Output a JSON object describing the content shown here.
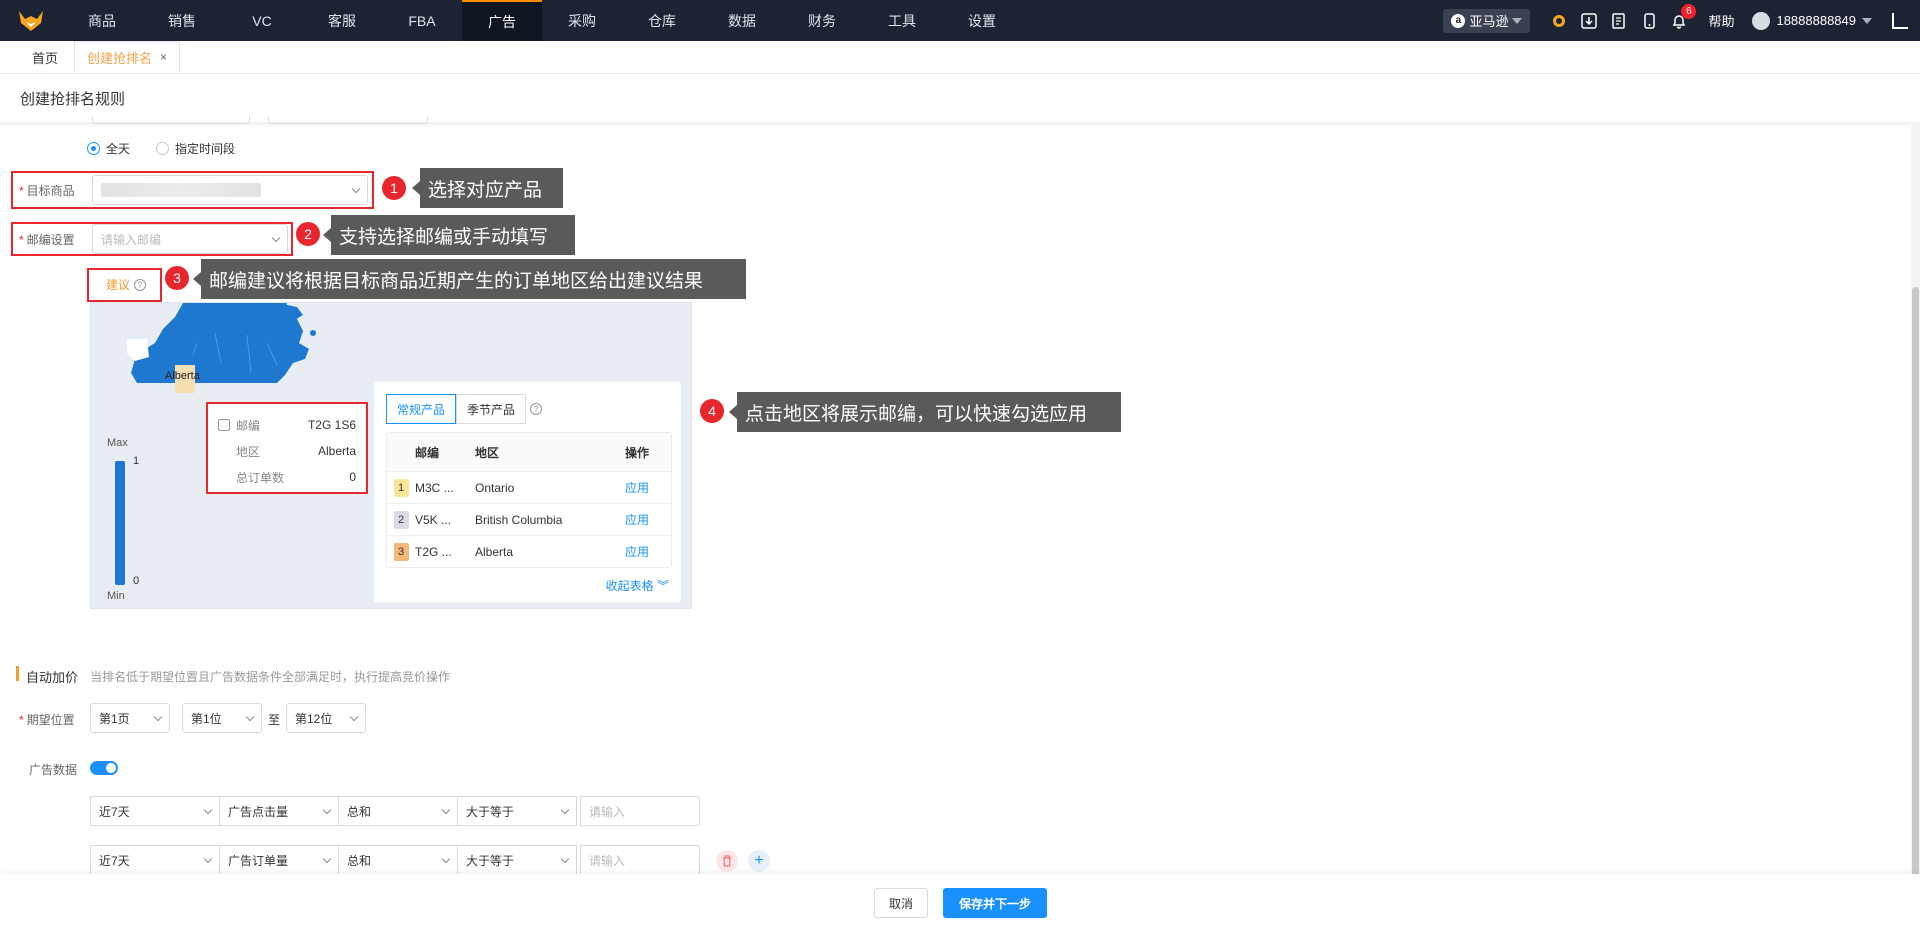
{
  "nav": {
    "items": [
      "商品",
      "销售",
      "VC",
      "客服",
      "FBA",
      "广告",
      "采购",
      "仓库",
      "数据",
      "财务",
      "工具",
      "设置"
    ],
    "active_index": 5,
    "store": "亚马逊",
    "notification_count": "6",
    "help": "帮助",
    "user": "18888888849"
  },
  "tabs": [
    {
      "label": "首页"
    },
    {
      "label": "创建抢排名",
      "close": "×"
    }
  ],
  "page_title": "创建抢排名规则",
  "time": {
    "options": [
      "全天",
      "指定时间段"
    ],
    "selected": "全天"
  },
  "target_product": {
    "label": "目标商品",
    "required": "*"
  },
  "zip_setting": {
    "label": "邮编设置",
    "required": "*",
    "placeholder": "请输入邮编"
  },
  "suggest_label": "建议",
  "callouts": [
    {
      "num": "1",
      "text": "选择对应产品"
    },
    {
      "num": "2",
      "text": "支持选择邮编或手动填写"
    },
    {
      "num": "3",
      "text": "邮编建议将根据目标商品近期产生的订单地区给出建议结果"
    },
    {
      "num": "4",
      "text": "点击地区将展示邮编，可以快速勾选应用"
    }
  ],
  "map": {
    "region_label": "Alberta",
    "legend_max": "Max",
    "legend_min": "Min",
    "legend_high": "1",
    "legend_low": "0",
    "fill_color": "#1e78d0",
    "highlight_color": "#f5deb0"
  },
  "tooltip": {
    "rows": [
      {
        "key": "邮编",
        "value": "T2G 1S6"
      },
      {
        "key": "地区",
        "value": "Alberta"
      },
      {
        "key": "总订单数",
        "value": "0"
      }
    ]
  },
  "zip_table": {
    "tabs": [
      "常规产品",
      "季节产品"
    ],
    "columns": [
      "邮编",
      "地区",
      "操作"
    ],
    "rows": [
      {
        "rank": "1",
        "zip": "M3C ...",
        "area": "Ontario",
        "action": "应用",
        "color": "#fbe59a"
      },
      {
        "rank": "2",
        "zip": "V5K ...",
        "area": "British Columbia",
        "action": "应用",
        "color": "#d9dde3"
      },
      {
        "rank": "3",
        "zip": "T2G ...",
        "area": "Alberta",
        "action": "应用",
        "color": "#f6b97b"
      }
    ],
    "collapse": "收起表格"
  },
  "auto_bid": {
    "title": "自动加价",
    "desc": "当排名低于期望位置且广告数据条件全部满足时，执行提高竞价操作",
    "position_label": "期望位置",
    "required": "*",
    "page": "第1页",
    "from": "第1位",
    "to_word": "至",
    "to": "第12位",
    "ad_data_label": "广告数据",
    "conditions": [
      {
        "period": "近7天",
        "metric": "广告点击量",
        "agg": "总和",
        "op": "大于等于",
        "placeholder": "请输入"
      },
      {
        "period": "近7天",
        "metric": "广告订单量",
        "agg": "总和",
        "op": "大于等于",
        "placeholder": "请输入"
      }
    ]
  },
  "footer": {
    "cancel": "取消",
    "save": "保存并下一步"
  }
}
